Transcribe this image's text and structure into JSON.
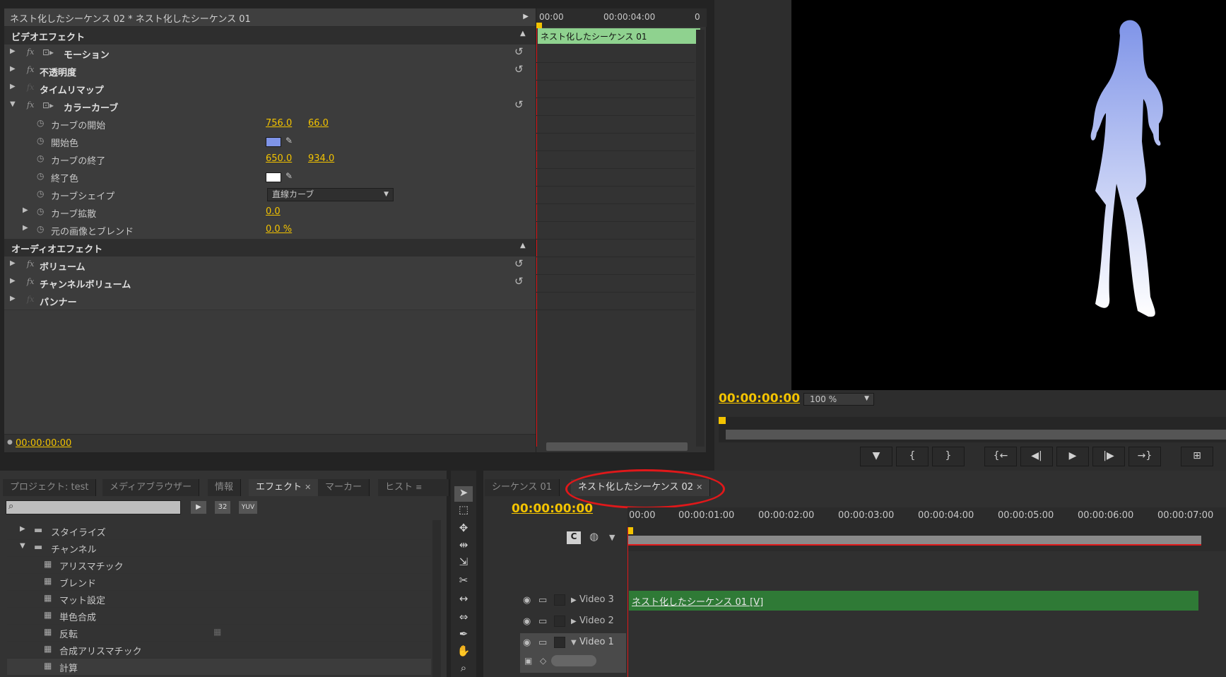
{
  "effect_controls": {
    "header": "ネスト化したシーケンス 02 * ネスト化したシーケンス 01",
    "mini_timeline": {
      "t0": "00:00",
      "t1": "00:00:04:00",
      "t2": "0",
      "clip": "ネスト化したシーケンス 01"
    },
    "sections": {
      "video": "ビデオエフェクト",
      "audio": "オーディオエフェクト"
    },
    "effects": {
      "motion": "モーション",
      "opacity": "不透明度",
      "time_remap": "タイムリマップ",
      "color_curve": "カラーカーブ",
      "volume": "ボリューム",
      "channel_volume": "チャンネルボリューム",
      "panner": "パンナー"
    },
    "params": {
      "curve_start": {
        "label": "カーブの開始",
        "v1": "756.0",
        "v2": "66.0"
      },
      "start_color": {
        "label": "開始色",
        "color": "#7f94e8"
      },
      "curve_end": {
        "label": "カーブの終了",
        "v1": "650.0",
        "v2": "934.0"
      },
      "end_color": {
        "label": "終了色",
        "color": "#ffffff"
      },
      "curve_shape": {
        "label": "カーブシェイプ",
        "value": "直線カーブ"
      },
      "curve_spread": {
        "label": "カーブ拡散",
        "value": "0.0"
      },
      "blend": {
        "label": "元の画像とブレンド",
        "value": "0.0 %"
      }
    },
    "timecode": "00:00:00:00"
  },
  "program": {
    "timecode": "00:00:00:00",
    "zoom": "100 %",
    "buttons": [
      "▼",
      "{",
      "}",
      "{←",
      "◀|",
      "▶",
      "|▶",
      "→}",
      "⊞"
    ]
  },
  "project_panel": {
    "tabs": [
      "プロジェクト: test",
      "メディアブラウザー",
      "情報",
      "エフェクト",
      "マーカー",
      "ヒスト"
    ],
    "active_tab": "エフェクト",
    "filter_icons": [
      "32",
      "YUV"
    ],
    "items": [
      {
        "label": "スタイライズ",
        "type": "folder",
        "expanded": false
      },
      {
        "label": "チャンネル",
        "type": "folder",
        "expanded": true
      },
      {
        "label": "アリスマチック",
        "type": "effect"
      },
      {
        "label": "ブレンド",
        "type": "effect"
      },
      {
        "label": "マット設定",
        "type": "effect"
      },
      {
        "label": "単色合成",
        "type": "effect"
      },
      {
        "label": "反転",
        "type": "effect"
      },
      {
        "label": "合成アリスマチック",
        "type": "effect"
      },
      {
        "label": "計算",
        "type": "effect"
      }
    ]
  },
  "timeline": {
    "tabs": [
      "シーケンス 01",
      "ネスト化したシーケンス 02"
    ],
    "active_tab": "ネスト化したシーケンス 02",
    "timecode": "00:00:00:00",
    "ruler": [
      "00:00",
      "00:00:01:00",
      "00:00:02:00",
      "00:00:03:00",
      "00:00:04:00",
      "00:00:05:00",
      "00:00:06:00",
      "00:00:07:00"
    ],
    "tracks": [
      {
        "name": "Video 3",
        "clip": "ネスト化したシーケンス 01 [V]"
      },
      {
        "name": "Video 2",
        "clip": ""
      },
      {
        "name": "Video 1",
        "clip": ""
      }
    ]
  },
  "colors": {
    "accent_yellow": "#f3c300",
    "clip_green": "#2f7a36",
    "mini_clip_green": "#8fd28f",
    "highlight_red": "#e0181a"
  }
}
